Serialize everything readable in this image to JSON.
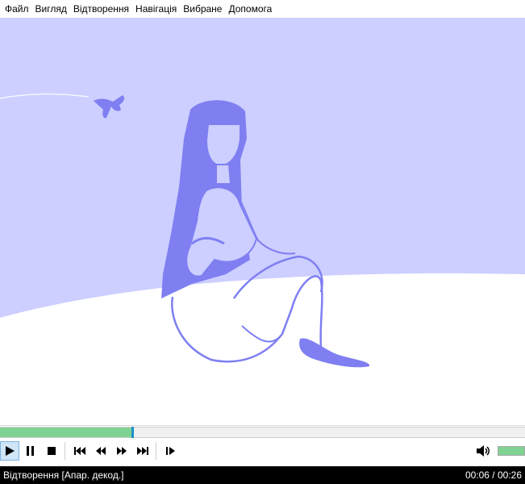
{
  "menu": {
    "items": [
      "Файл",
      "Вигляд",
      "Відтворення",
      "Навігація",
      "Вибране",
      "Допомога"
    ]
  },
  "video": {
    "background_color": "#cccfff",
    "figure_color": "#7f7ff2"
  },
  "seek": {
    "progress": 0.25,
    "fill_color": "#7fd291",
    "handle_color": "#1d8fc9"
  },
  "controls": {
    "icons": [
      "play-icon",
      "pause-icon",
      "stop-icon",
      "skip-previous-icon",
      "rewind-icon",
      "fast-forward-icon",
      "skip-next-icon",
      "frame-step-icon"
    ],
    "volume_icon": "speaker-icon",
    "volume_level": 1.0
  },
  "status": {
    "text": "Відтворення [Апар. декод.]",
    "time": "00:06 / 00:26"
  }
}
